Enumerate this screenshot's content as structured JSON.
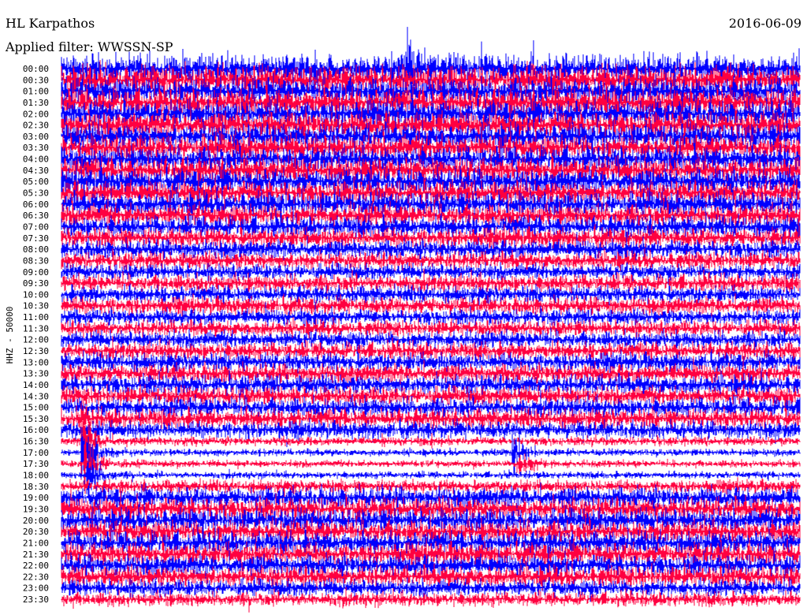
{
  "chart_data": {
    "type": "line",
    "title": "HL Karpathos",
    "subtitle": "Applied filter: WWSSN-SP",
    "date": "2016-06-09",
    "ylabel": "HHZ - 50000",
    "row_minutes": 30,
    "colors": [
      "#0000ff",
      "#ff0040"
    ],
    "rows": [
      "00:00",
      "00:30",
      "01:00",
      "01:30",
      "02:00",
      "02:30",
      "03:00",
      "03:30",
      "04:00",
      "04:30",
      "05:00",
      "05:30",
      "06:00",
      "06:30",
      "07:00",
      "07:30",
      "08:00",
      "08:30",
      "09:00",
      "09:30",
      "10:00",
      "10:30",
      "11:00",
      "11:30",
      "12:00",
      "12:30",
      "13:00",
      "13:30",
      "14:00",
      "14:30",
      "15:00",
      "15:30",
      "16:00",
      "16:30",
      "17:00",
      "17:30",
      "18:00",
      "18:30",
      "19:00",
      "19:30",
      "20:00",
      "20:30",
      "21:00",
      "21:30",
      "22:00",
      "22:30",
      "23:00",
      "23:30"
    ],
    "relative_amplitude": [
      1.0,
      1.0,
      1.0,
      1.0,
      0.95,
      0.95,
      0.9,
      0.9,
      0.9,
      0.9,
      0.9,
      0.85,
      0.85,
      0.8,
      0.75,
      0.7,
      0.65,
      0.6,
      0.55,
      0.6,
      0.6,
      0.6,
      0.55,
      0.55,
      0.6,
      0.6,
      0.65,
      0.65,
      0.7,
      0.65,
      0.7,
      0.7,
      0.6,
      0.3,
      0.25,
      0.25,
      0.25,
      0.45,
      0.75,
      0.8,
      0.8,
      0.8,
      0.8,
      0.8,
      0.75,
      0.75,
      0.6,
      0.5
    ],
    "events": [
      {
        "row": "16:30",
        "minute": 0.8,
        "amplitude": 3.0
      },
      {
        "row": "17:00",
        "minute": 0.8,
        "amplitude": 4.0
      },
      {
        "row": "17:30",
        "minute": 0.9,
        "amplitude": 3.5
      },
      {
        "row": "18:00",
        "minute": 1.0,
        "amplitude": 2.5
      },
      {
        "row": "17:00",
        "minute": 18.3,
        "amplitude": 1.5
      },
      {
        "row": "17:30",
        "minute": 18.5,
        "amplitude": 1.5
      },
      {
        "row": "00:00",
        "minute": 14.0,
        "amplitude": 3.0
      }
    ]
  }
}
